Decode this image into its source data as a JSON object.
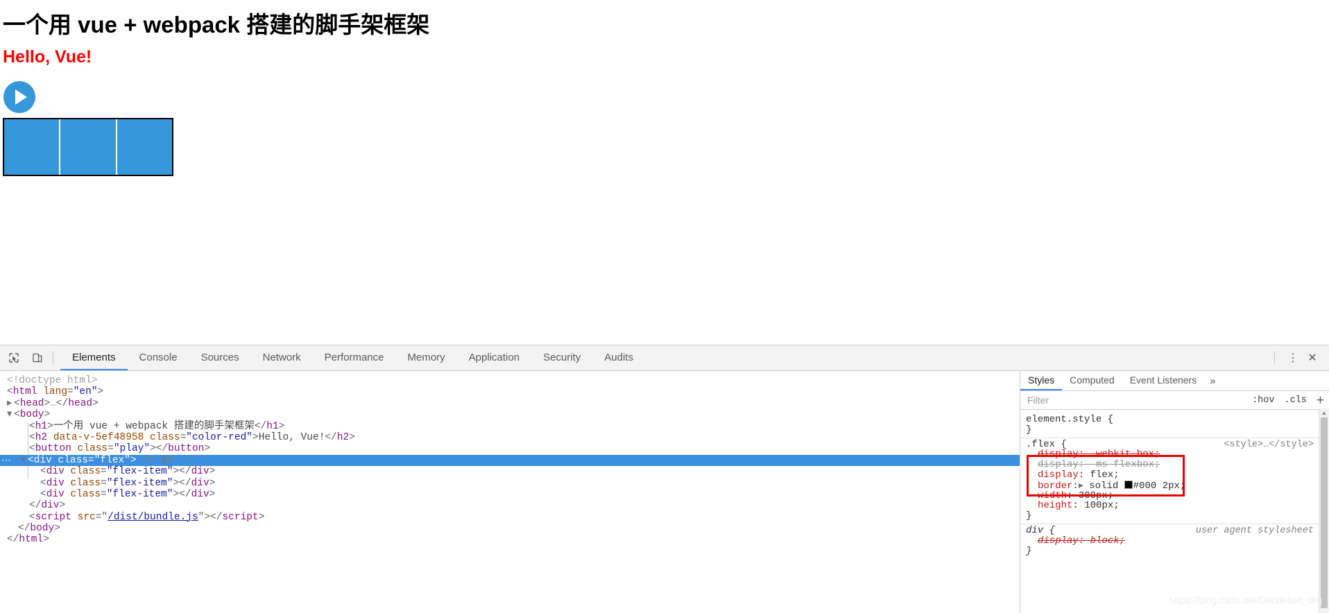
{
  "page": {
    "h1": "一个用 vue + webpack 搭建的脚手架框架",
    "h2": "Hello, Vue!",
    "play_button_label": "",
    "flex_items": [
      "",
      "",
      ""
    ],
    "colors": {
      "accent_blue": "#3498db",
      "heading_red": "#ff0000",
      "border_black": "#000000"
    }
  },
  "devtools": {
    "toolbar": {
      "inspect_icon": "inspect-cursor-icon",
      "device_icon": "device-toolbar-icon",
      "more_label": "⋮",
      "close_label": "✕"
    },
    "tabs": [
      {
        "label": "Elements",
        "active": true
      },
      {
        "label": "Console",
        "active": false
      },
      {
        "label": "Sources",
        "active": false
      },
      {
        "label": "Network",
        "active": false
      },
      {
        "label": "Performance",
        "active": false
      },
      {
        "label": "Memory",
        "active": false
      },
      {
        "label": "Application",
        "active": false
      },
      {
        "label": "Security",
        "active": false
      },
      {
        "label": "Audits",
        "active": false
      }
    ],
    "dom": {
      "lines": [
        {
          "id": "l0",
          "text": "<!doctype html>"
        },
        {
          "id": "l1",
          "text": "<html lang=\"en\">"
        },
        {
          "id": "l2",
          "text": "<head>…</head>"
        },
        {
          "id": "l3",
          "text": "<body>"
        },
        {
          "id": "l4",
          "text": "<h1>一个用 vue + webpack 搭建的脚手架框架</h1>"
        },
        {
          "id": "l5",
          "text": "<h2 data-v-5ef48958 class=\"color-red\">Hello, Vue!</h2>"
        },
        {
          "id": "l6",
          "text": "<button class=\"play\"></button>"
        },
        {
          "id": "l7",
          "text": "<div class=\"flex\"> == $0",
          "selected": true
        },
        {
          "id": "l8",
          "text": "<div class=\"flex-item\"></div>"
        },
        {
          "id": "l9",
          "text": "<div class=\"flex-item\"></div>"
        },
        {
          "id": "l10",
          "text": "<div class=\"flex-item\"></div>"
        },
        {
          "id": "l11",
          "text": "</div>"
        },
        {
          "id": "l12",
          "text": "<script src=\"/dist/bundle.js\"></script>"
        },
        {
          "id": "l13",
          "text": "</body>"
        },
        {
          "id": "l14",
          "text": "</html>"
        }
      ],
      "head_tag": "head",
      "body_tag": "body",
      "html_tag": "html",
      "doctype": "<!doctype html>",
      "html_attr_name": "lang",
      "html_attr_value": "\"en\"",
      "h1_text": "一个用 vue + webpack 搭建的脚手架框架",
      "h2_attr1": "data-v-5ef48958",
      "h2_attr2_name": "class",
      "h2_attr2_value": "\"color-red\"",
      "h2_text": "Hello, Vue!",
      "button_class": "\"play\"",
      "flex_class": "\"flex\"",
      "flex_item_class": "\"flex-item\"",
      "selected_marker": "== $0",
      "script_src": "/dist/bundle.js",
      "ellipsis": "…"
    },
    "styles": {
      "tabs": [
        {
          "label": "Styles",
          "active": true
        },
        {
          "label": "Computed",
          "active": false
        },
        {
          "label": "Event Listeners",
          "active": false
        }
      ],
      "more_tabs": "»",
      "filter_placeholder": "Filter",
      "filter_value": "",
      "hov_label": ":hov",
      "cls_label": ".cls",
      "plus_label": "+",
      "rules": [
        {
          "selector": "element.style {",
          "close": "}",
          "origin": "",
          "declarations": []
        },
        {
          "selector": ".flex {",
          "close": "}",
          "origin": "<style>…</style>",
          "declarations": [
            {
              "property": "display",
              "value": "-webkit-box;",
              "state": "strike-red"
            },
            {
              "property": "display",
              "value": "-ms-flexbox;",
              "state": "strike-gray"
            },
            {
              "property": "display",
              "value": "flex;",
              "state": "active"
            },
            {
              "property": "border",
              "value": "solid #000 2px;",
              "state": "active",
              "swatch": "#000000",
              "disclosure": true
            },
            {
              "property": "width",
              "value": "300px;",
              "state": "active"
            },
            {
              "property": "height",
              "value": "100px;",
              "state": "active"
            }
          ]
        },
        {
          "selector": "div {",
          "close": "}",
          "origin": "user agent stylesheet",
          "origin_italic": true,
          "declarations": [
            {
              "property": "display",
              "value": "block;",
              "state": "strike-red"
            }
          ]
        }
      ]
    },
    "watermark": "https://blog.csdn.net/Dandelion_drq"
  }
}
